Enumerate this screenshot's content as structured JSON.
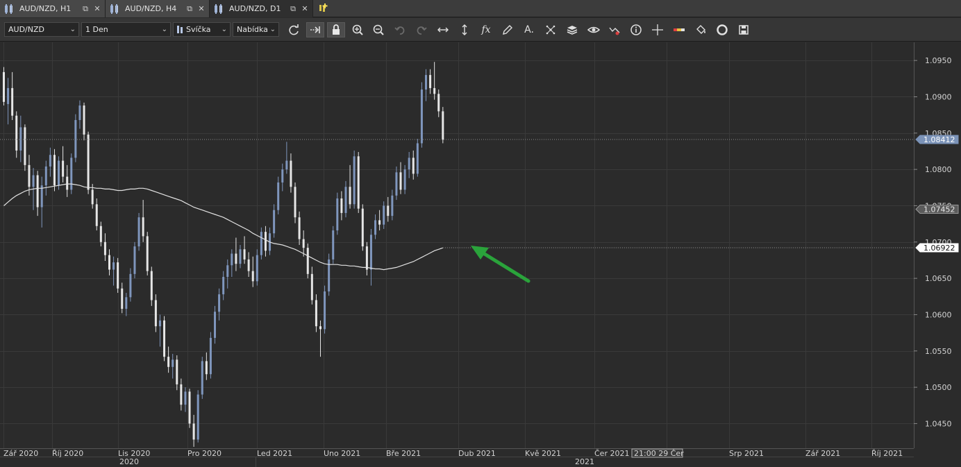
{
  "tabs": [
    {
      "label": "AUD/NZD, H1",
      "active": false
    },
    {
      "label": "AUD/NZD, H4",
      "active": false
    },
    {
      "label": "AUD/NZD, D1",
      "active": true
    }
  ],
  "toolbar": {
    "symbol": "AUD/NZD",
    "timeframe": "1 Den",
    "chart_type": "Svíčka",
    "price_type": "Nabídka",
    "icons": [
      "refresh-icon",
      "auto-scroll-icon",
      "lock-icon",
      "zoom-in-icon",
      "zoom-out-icon",
      "undo-icon",
      "redo-icon",
      "horizontal-resize-icon",
      "vertical-resize-icon",
      "indicators-fx-icon",
      "pencil-icon",
      "text-tool-icon",
      "fractal-icon",
      "layers-icon",
      "eye-icon",
      "alert-chart-icon",
      "info-icon",
      "crosshair-icon",
      "color-bar-icon",
      "paint-bucket-icon",
      "template-icon",
      "save-icon"
    ]
  },
  "colors": {
    "background": "#2b2b2b",
    "bull_candle": "#7f96bd",
    "bear_candle": "#e6e6e6",
    "moving_average": "#e2e2e2",
    "arrow": "#2aa33b",
    "price_label_current": "#7b93b8"
  },
  "chart_data": {
    "type": "candlestick",
    "symbol": "AUD/NZD",
    "timeframe": "D1",
    "ylim": [
      1.0416,
      1.0975
    ],
    "yticks": [
      "1.0950",
      "1.0900",
      "1.0850",
      "1.0800",
      "1.0750",
      "1.0700",
      "1.0650",
      "1.0600",
      "1.0550",
      "1.0500",
      "1.0450"
    ],
    "xticks": [
      "Zář 2020",
      "Říj 2020",
      "Lis 2020",
      "Pro 2020",
      "Led 2021",
      "Uno 2021",
      "Bře 2021",
      "Dub 2021",
      "Kvě 2021",
      "Čer 2021",
      "021",
      "Srp 2021",
      "Zář 2021",
      "Říj 2021"
    ],
    "year_labels": [
      "2020",
      "2021"
    ],
    "crosshair_time_label": "21:00 29 Čer",
    "price_labels": [
      {
        "value": "1.08412",
        "kind": "current"
      },
      {
        "value": "1.07452",
        "kind": "level"
      },
      {
        "value": "1.06922",
        "kind": "indicator"
      }
    ],
    "candles": [
      [
        1.0934,
        1.0941,
        1.0888,
        1.0893
      ],
      [
        1.089,
        1.0926,
        1.0862,
        1.0912
      ],
      [
        1.0912,
        1.0934,
        1.0868,
        1.0874
      ],
      [
        1.0874,
        1.088,
        1.0816,
        1.0826
      ],
      [
        1.0826,
        1.0874,
        1.081,
        1.0858
      ],
      [
        1.0858,
        1.0862,
        1.0798,
        1.0806
      ],
      [
        1.0806,
        1.082,
        1.0764,
        1.0776
      ],
      [
        1.0776,
        1.0802,
        1.0744,
        1.0792
      ],
      [
        1.0792,
        1.0798,
        1.0736,
        1.0748
      ],
      [
        1.0748,
        1.079,
        1.072,
        1.0778
      ],
      [
        1.0778,
        1.0812,
        1.0764,
        1.0804
      ],
      [
        1.0804,
        1.083,
        1.079,
        1.082
      ],
      [
        1.082,
        1.0828,
        1.077,
        1.0778
      ],
      [
        1.0778,
        1.0818,
        1.0772,
        1.0812
      ],
      [
        1.0812,
        1.0832,
        1.0782,
        1.079
      ],
      [
        1.079,
        1.0806,
        1.0762,
        1.0772
      ],
      [
        1.0772,
        1.0822,
        1.0766,
        1.0816
      ],
      [
        1.0816,
        1.0876,
        1.081,
        1.0868
      ],
      [
        1.0868,
        1.0895,
        1.0856,
        1.0888
      ],
      [
        1.0888,
        1.0892,
        1.084,
        1.0848
      ],
      [
        1.0848,
        1.0852,
        1.0766,
        1.0772
      ],
      [
        1.0772,
        1.078,
        1.0746,
        1.0752
      ],
      [
        1.0752,
        1.076,
        1.0716,
        1.0722
      ],
      [
        1.0722,
        1.0728,
        1.0694,
        1.07
      ],
      [
        1.07,
        1.0712,
        1.0674,
        1.0682
      ],
      [
        1.0682,
        1.069,
        1.0654,
        1.0662
      ],
      [
        1.0662,
        1.068,
        1.064,
        1.0672
      ],
      [
        1.0672,
        1.0678,
        1.063,
        1.0636
      ],
      [
        1.0636,
        1.0644,
        1.0602,
        1.0608
      ],
      [
        1.0608,
        1.063,
        1.0598,
        1.0624
      ],
      [
        1.0624,
        1.0664,
        1.0618,
        1.0656
      ],
      [
        1.0656,
        1.07,
        1.065,
        1.0694
      ],
      [
        1.0694,
        1.074,
        1.0688,
        1.0734
      ],
      [
        1.0734,
        1.0758,
        1.07,
        1.0708
      ],
      [
        1.0708,
        1.0714,
        1.0654,
        1.066
      ],
      [
        1.066,
        1.0666,
        1.0612,
        1.062
      ],
      [
        1.062,
        1.0628,
        1.0576,
        1.0584
      ],
      [
        1.0584,
        1.06,
        1.0556,
        1.0592
      ],
      [
        1.0592,
        1.0598,
        1.0536,
        1.0542
      ],
      [
        1.0542,
        1.0556,
        1.052,
        1.0528
      ],
      [
        1.0528,
        1.0546,
        1.0512,
        1.0538
      ],
      [
        1.0538,
        1.0544,
        1.0496,
        1.0504
      ],
      [
        1.0504,
        1.0512,
        1.0468,
        1.0476
      ],
      [
        1.0476,
        1.05,
        1.0466,
        1.0494
      ],
      [
        1.0494,
        1.0498,
        1.0444,
        1.045
      ],
      [
        1.045,
        1.0462,
        1.0418,
        1.0428
      ],
      [
        1.0428,
        1.0496,
        1.0424,
        1.049
      ],
      [
        1.049,
        1.0542,
        1.0484,
        1.0536
      ],
      [
        1.0536,
        1.0548,
        1.051,
        1.0518
      ],
      [
        1.0518,
        1.0576,
        1.0512,
        1.0568
      ],
      [
        1.0568,
        1.0612,
        1.056,
        1.0604
      ],
      [
        1.0604,
        1.0636,
        1.0592,
        1.0628
      ],
      [
        1.0628,
        1.066,
        1.062,
        1.0652
      ],
      [
        1.0652,
        1.0676,
        1.0636,
        1.0668
      ],
      [
        1.0668,
        1.069,
        1.0652,
        1.0684
      ],
      [
        1.0684,
        1.0706,
        1.066,
        1.067
      ],
      [
        1.067,
        1.0696,
        1.0664,
        1.069
      ],
      [
        1.069,
        1.0708,
        1.067,
        1.0676
      ],
      [
        1.0676,
        1.0686,
        1.0652,
        1.066
      ],
      [
        1.066,
        1.068,
        1.0638,
        1.0646
      ],
      [
        1.0646,
        1.069,
        1.064,
        1.0682
      ],
      [
        1.0682,
        1.072,
        1.0676,
        1.0714
      ],
      [
        1.0714,
        1.0722,
        1.068,
        1.0688
      ],
      [
        1.0688,
        1.072,
        1.0682,
        1.0712
      ],
      [
        1.0712,
        1.0752,
        1.0706,
        1.0744
      ],
      [
        1.0744,
        1.079,
        1.0738,
        1.0782
      ],
      [
        1.0782,
        1.0808,
        1.077,
        1.08
      ],
      [
        1.08,
        1.0838,
        1.0794,
        1.0812
      ],
      [
        1.0812,
        1.0822,
        1.0768,
        1.0776
      ],
      [
        1.0776,
        1.0782,
        1.0726,
        1.0734
      ],
      [
        1.0734,
        1.0742,
        1.0696,
        1.0704
      ],
      [
        1.0704,
        1.0716,
        1.068,
        1.0692
      ],
      [
        1.0692,
        1.0698,
        1.065,
        1.0656
      ],
      [
        1.0656,
        1.0666,
        1.0614,
        1.062
      ],
      [
        1.062,
        1.0628,
        1.0576,
        1.0584
      ],
      [
        1.0584,
        1.0592,
        1.0542,
        1.058
      ],
      [
        1.058,
        1.064,
        1.0574,
        1.0632
      ],
      [
        1.0632,
        1.0684,
        1.0626,
        1.0676
      ],
      [
        1.0676,
        1.0722,
        1.067,
        1.0716
      ],
      [
        1.0716,
        1.0768,
        1.071,
        1.076
      ],
      [
        1.076,
        1.077,
        1.073,
        1.074
      ],
      [
        1.074,
        1.0784,
        1.0734,
        1.0776
      ],
      [
        1.0776,
        1.0806,
        1.0746,
        1.0752
      ],
      [
        1.0752,
        1.0826,
        1.0746,
        1.0818
      ],
      [
        1.0818,
        1.0824,
        1.074,
        1.0746
      ],
      [
        1.0746,
        1.0752,
        1.0688,
        1.0694
      ],
      [
        1.0694,
        1.07,
        1.0654,
        1.0662
      ],
      [
        1.0662,
        1.0718,
        1.064,
        1.071
      ],
      [
        1.071,
        1.0738,
        1.0704,
        1.073
      ],
      [
        1.073,
        1.0744,
        1.0716,
        1.0724
      ],
      [
        1.0724,
        1.0756,
        1.0718,
        1.075
      ],
      [
        1.075,
        1.0762,
        1.0728,
        1.0736
      ],
      [
        1.0736,
        1.0772,
        1.073,
        1.0764
      ],
      [
        1.0764,
        1.0804,
        1.0758,
        1.0796
      ],
      [
        1.0796,
        1.081,
        1.0766,
        1.0772
      ],
      [
        1.0772,
        1.0806,
        1.0766,
        1.08
      ],
      [
        1.08,
        1.0824,
        1.0788,
        1.0816
      ],
      [
        1.0816,
        1.0826,
        1.0786,
        1.0794
      ],
      [
        1.0794,
        1.0842,
        1.079,
        1.0836
      ],
      [
        1.0836,
        1.092,
        1.083,
        1.091
      ],
      [
        1.091,
        1.0938,
        1.0894,
        1.093
      ],
      [
        1.093,
        1.0938,
        1.0904,
        1.0912
      ],
      [
        1.0912,
        1.0948,
        1.0896,
        1.0904
      ],
      [
        1.0904,
        1.091,
        1.0872,
        1.088
      ],
      [
        1.088,
        1.0886,
        1.0836,
        1.0841
      ]
    ],
    "moving_average": [
      1.075,
      1.0755,
      1.076,
      1.0764,
      1.0767,
      1.077,
      1.0772,
      1.0773,
      1.0774,
      1.0774,
      1.0775,
      1.0776,
      1.0777,
      1.0778,
      1.0779,
      1.078,
      1.078,
      1.0779,
      1.0778,
      1.0776,
      1.0775,
      1.0775,
      1.0774,
      1.0774,
      1.0773,
      1.0773,
      1.0772,
      1.0771,
      1.0771,
      1.0772,
      1.0773,
      1.0773,
      1.0774,
      1.0774,
      1.0773,
      1.0771,
      1.0769,
      1.0767,
      1.0765,
      1.0763,
      1.0761,
      1.0759,
      1.0757,
      1.0754,
      1.0751,
      1.0748,
      1.0746,
      1.0744,
      1.0742,
      1.074,
      1.0738,
      1.0736,
      1.0734,
      1.0731,
      1.0728,
      1.0725,
      1.0722,
      1.0719,
      1.0716,
      1.0712,
      1.0709,
      1.0706,
      1.0703,
      1.07,
      1.0698,
      1.0697,
      1.0696,
      1.0694,
      1.0692,
      1.069,
      1.0687,
      1.0684,
      1.0681,
      1.0678,
      1.0675,
      1.0672,
      1.067,
      1.0669,
      1.0669,
      1.0669,
      1.0668,
      1.0668,
      1.0667,
      1.0667,
      1.0666,
      1.0665,
      1.0665,
      1.0664,
      1.0663,
      1.0663,
      1.0662,
      1.0663,
      1.0664,
      1.0665,
      1.0667,
      1.0669,
      1.0671,
      1.0673,
      1.0676,
      1.0679,
      1.0682,
      1.0685,
      1.0688,
      1.069,
      1.0692
    ]
  }
}
